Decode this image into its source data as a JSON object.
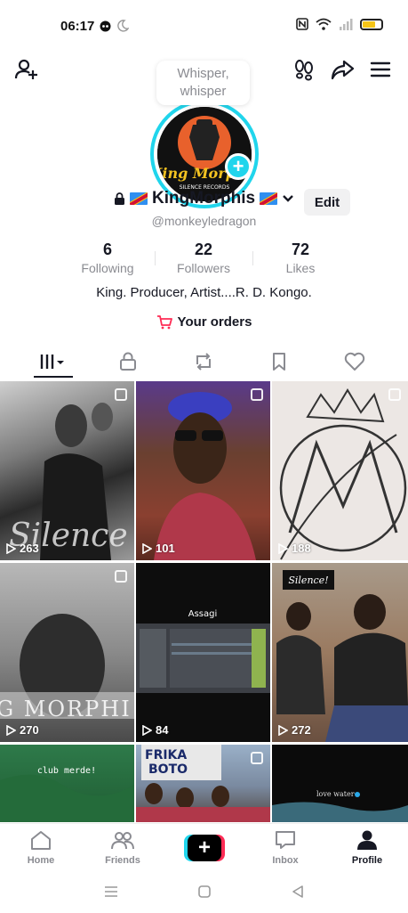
{
  "status": {
    "time": "06:17"
  },
  "bubble": {
    "text": "Whisper, whisper"
  },
  "profile": {
    "name": "KingMorphis",
    "handle": "@monkeyledragon",
    "edit_label": "Edit",
    "avatar_text": "King Morphis",
    "avatar_subtext": "SILENCE RECORDS"
  },
  "stats": [
    {
      "value": "6",
      "label": "Following"
    },
    {
      "value": "22",
      "label": "Followers"
    },
    {
      "value": "72",
      "label": "Likes"
    }
  ],
  "bio": "King. Producer, Artist....R. D. Kongo.",
  "orders_label": "Your orders",
  "videos": [
    {
      "views": "263"
    },
    {
      "views": "101"
    },
    {
      "views": "188"
    },
    {
      "views": "270"
    },
    {
      "views": "84"
    },
    {
      "views": "272"
    },
    {
      "views": ""
    },
    {
      "views": ""
    },
    {
      "views": ""
    }
  ],
  "video_texts": {
    "assagi": "Assagi",
    "silence": "Silence!",
    "club": "club merde!",
    "love": "love water",
    "afrika": "FRIKA",
    "boto": "BOTO",
    "morphi": "G MORPHI",
    "silence_script": "Silence"
  },
  "nav": {
    "home": "Home",
    "friends": "Friends",
    "inbox": "Inbox",
    "profile": "Profile"
  },
  "colors": {
    "accent": "#20d5ec",
    "brand_red": "#fe2c55",
    "text": "#161823",
    "muted": "#8a8b91"
  }
}
